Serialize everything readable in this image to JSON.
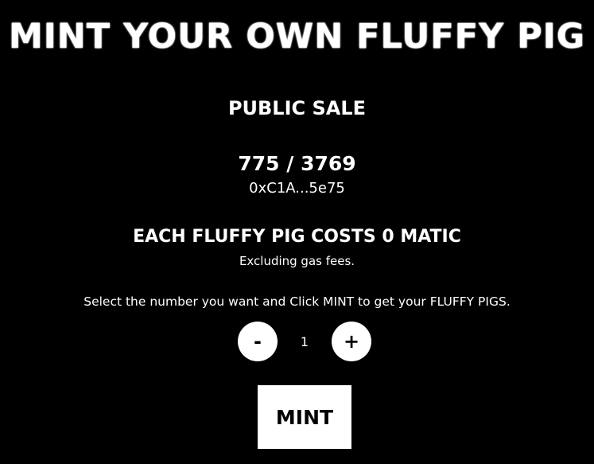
{
  "header": {
    "title": "MINT YOUR OWN FLUFFY PIG"
  },
  "sale": {
    "phase_label": "PUBLIC SALE",
    "supply_text": "775 / 3769",
    "minted": 775,
    "max_supply": 3769,
    "contract_address": "0xC1A...5e75"
  },
  "pricing": {
    "cost_text": "EACH FLUFFY PIG COSTS 0 MATIC",
    "gas_note": "Excluding gas fees."
  },
  "mint": {
    "instructions": "Select the number you want and Click MINT to get your FLUFFY PIGS.",
    "decrement_label": "-",
    "quantity": "1",
    "increment_label": "+",
    "mint_label": "MINT"
  },
  "colors": {
    "background": "#000000",
    "text": "#ffffff",
    "button_bg": "#ffffff",
    "button_text": "#000000"
  }
}
